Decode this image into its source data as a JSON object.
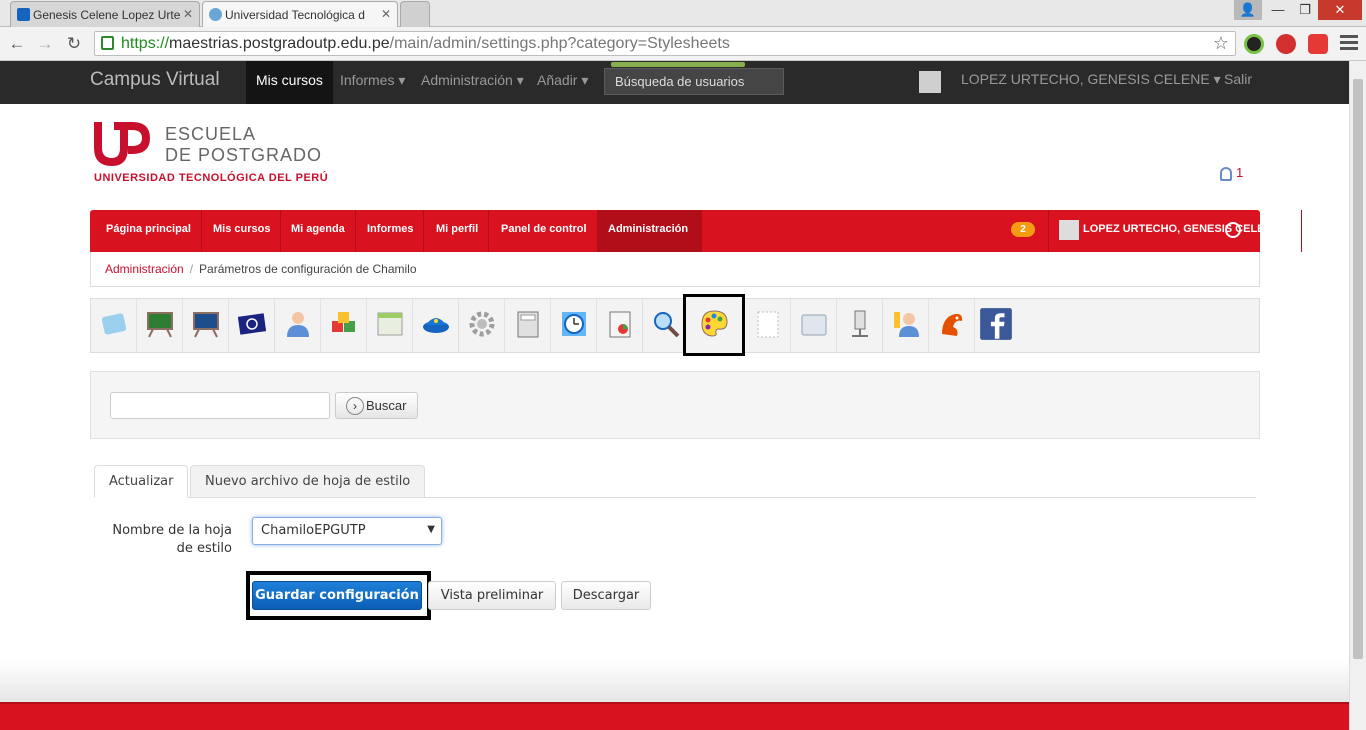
{
  "browser": {
    "tabs": [
      {
        "title": "Genesis Celene Lopez Urte"
      },
      {
        "title": "Universidad Tecnológica d"
      }
    ],
    "url_scheme": "https://",
    "url_host": "maestrias.postgradoutp.edu.pe",
    "url_path": "/main/admin/settings.php?category=Stylesheets"
  },
  "topbar": {
    "brand": "Campus Virtual",
    "items": [
      {
        "label": "Mis cursos"
      },
      {
        "label": "Informes ▾"
      },
      {
        "label": "Administración ▾"
      },
      {
        "label": "Añadir ▾"
      }
    ],
    "search_placeholder": "Búsqueda de usuarios",
    "user_name": "LOPEZ URTECHO, GENESIS CELENE ▾",
    "exit": "Salir"
  },
  "logo": {
    "line1": "ESCUELA",
    "line2": "DE POSTGRADO",
    "line3": "UNIVERSIDAD TECNOLÓGICA DEL PERÚ"
  },
  "notifications": {
    "count": "1"
  },
  "rednav": {
    "items": [
      {
        "label": "Página principal"
      },
      {
        "label": "Mis cursos"
      },
      {
        "label": "Mi agenda"
      },
      {
        "label": "Informes"
      },
      {
        "label": "Mi perfil"
      },
      {
        "label": "Panel de control"
      },
      {
        "label": "Administración"
      }
    ],
    "badge": "2",
    "user": "LOPEZ URTECHO, GENESIS CELENE ▾"
  },
  "breadcrumb": {
    "root": "Administración",
    "sep": "/",
    "current": "Parámetros de configuración de Chamilo"
  },
  "search": {
    "button": "Buscar"
  },
  "tabs": [
    {
      "label": "Actualizar"
    },
    {
      "label": "Nuevo archivo de hoja de estilo"
    }
  ],
  "form": {
    "label": "Nombre de la hoja de estilo",
    "select_value": "ChamiloEPGUTP"
  },
  "buttons": {
    "save": "Guardar configuración",
    "preview": "Vista preliminar",
    "download": "Descargar"
  },
  "colors": {
    "brand_red": "#d9121f",
    "primary_blue": "#0b5fb5"
  }
}
